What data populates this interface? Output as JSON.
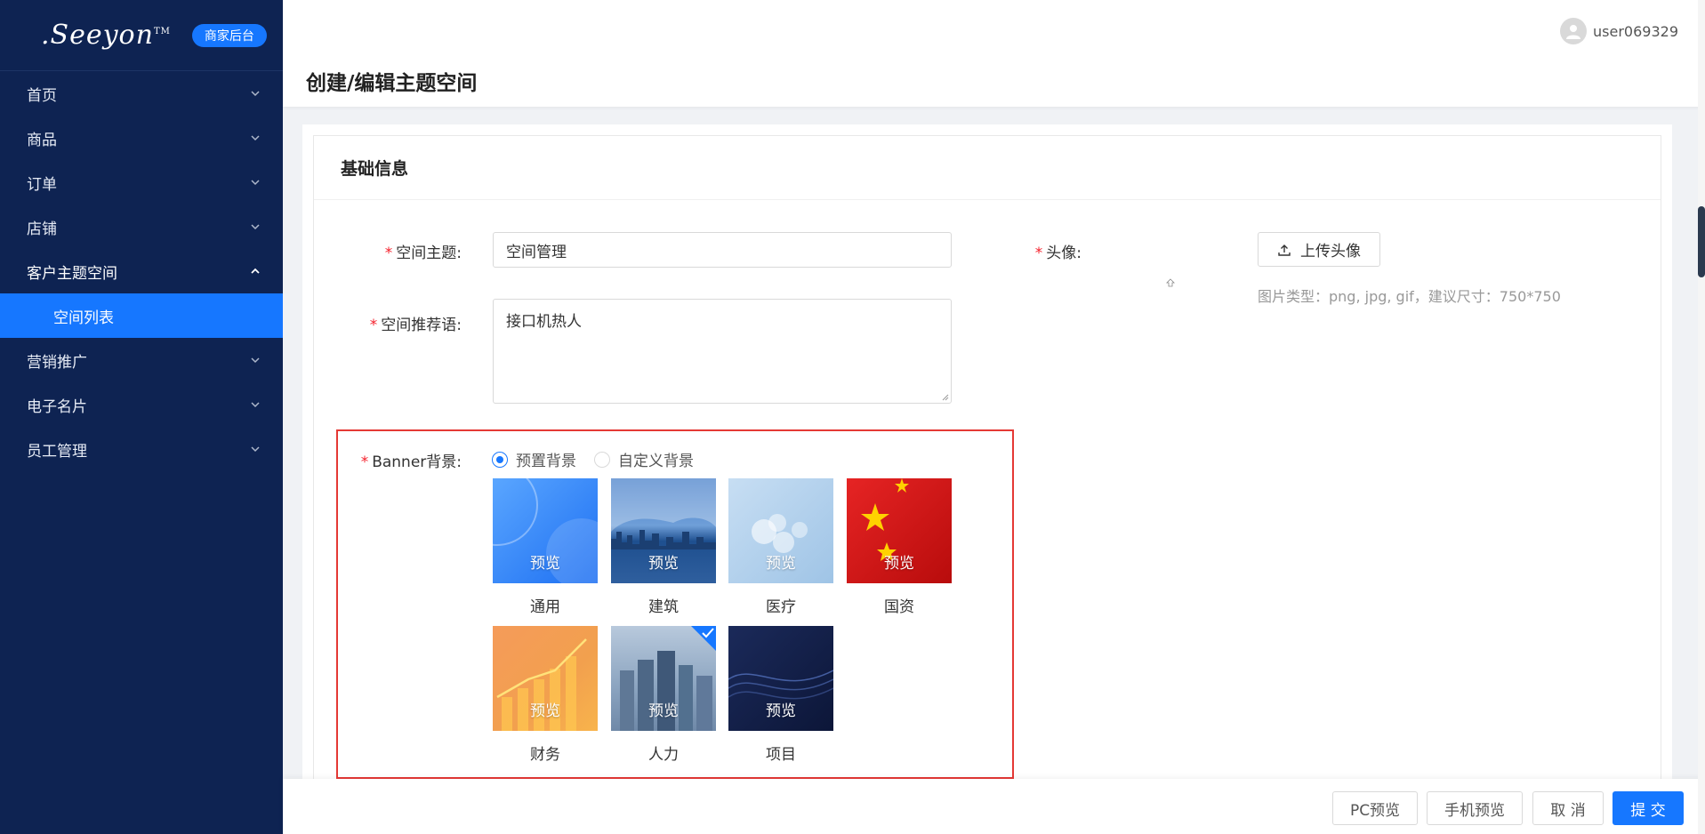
{
  "sidebar": {
    "logo": ".Seeyon",
    "logo_tm": "TM",
    "badge": "商家后台",
    "menu": [
      {
        "label": "首页"
      },
      {
        "label": "商品"
      },
      {
        "label": "订单"
      },
      {
        "label": "店铺"
      },
      {
        "label": "客户主题空间"
      },
      {
        "label": "营销推广"
      },
      {
        "label": "电子名片"
      },
      {
        "label": "员工管理"
      }
    ],
    "submenu_active": "空间列表"
  },
  "header": {
    "title": "创建/编辑主题空间",
    "username": "user069329"
  },
  "section_title": "基础信息",
  "form": {
    "topic_label": "空间主题:",
    "topic_value": "空间管理",
    "slogan_label": "空间推荐语:",
    "slogan_value": "接口机热人",
    "avatar_label": "头像:",
    "upload_label": "上传头像",
    "upload_hint": "图片类型：png, jpg, gif，建议尺寸：750*750",
    "banner_label": "Banner背景:",
    "radio_preset": "预置背景",
    "radio_custom": "自定义背景",
    "preview_text": "预览",
    "backgrounds": [
      {
        "caption": "通用"
      },
      {
        "caption": "建筑"
      },
      {
        "caption": "医疗"
      },
      {
        "caption": "国资"
      },
      {
        "caption": "财务"
      },
      {
        "caption": "人力",
        "selected": true
      },
      {
        "caption": "项目"
      }
    ]
  },
  "footer": {
    "pc_preview": "PC预览",
    "mobile_preview": "手机预览",
    "cancel": "取 消",
    "submit": "提 交"
  },
  "colors": {
    "sidebar_bg": "#0e2352",
    "accent": "#1677ff",
    "required": "#f5222d",
    "highlight_border": "#e53935"
  }
}
